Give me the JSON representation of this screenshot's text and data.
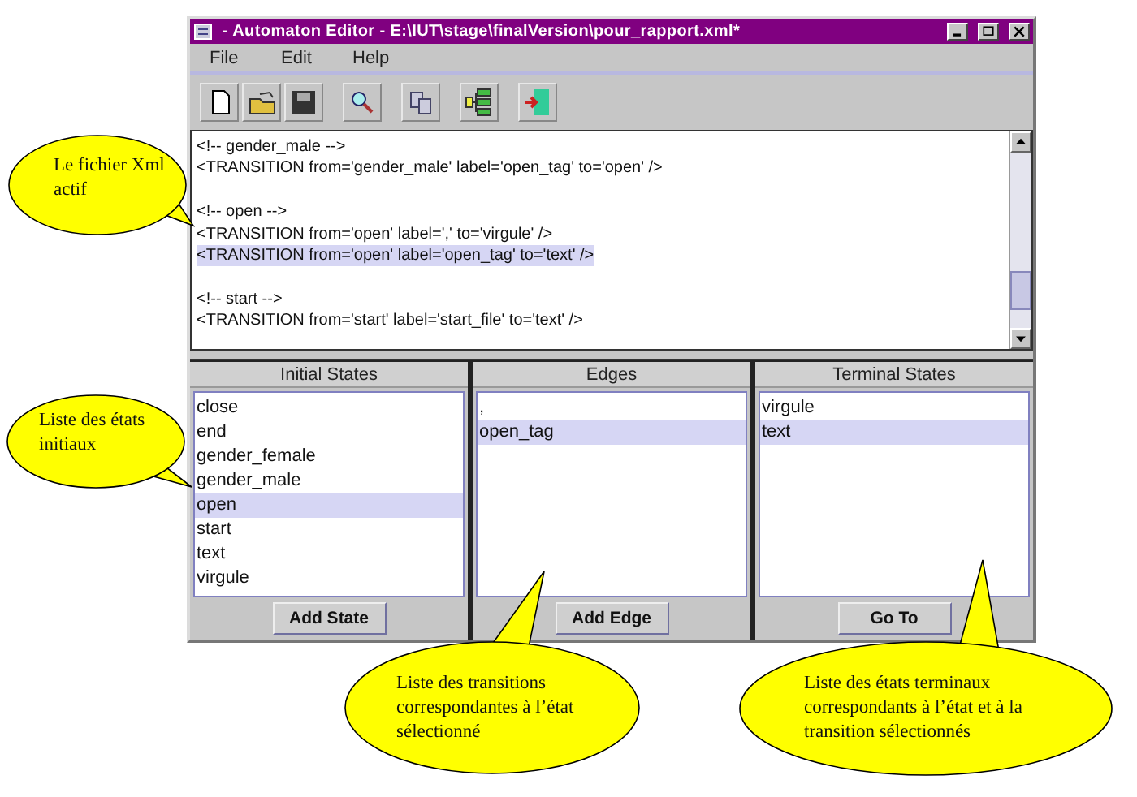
{
  "window": {
    "title": "- Automaton Editor - E:\\IUT\\stage\\finalVersion\\pour_rapport.xml*"
  },
  "menu": [
    "File",
    "Edit",
    "Help"
  ],
  "editor": {
    "lines": [
      {
        "kind": "text",
        "text": "<!-- gender_male -->",
        "selected": false
      },
      {
        "kind": "text",
        "text": "<TRANSITION from='gender_male' label='open_tag' to='open' />",
        "selected": false
      },
      {
        "kind": "blank"
      },
      {
        "kind": "text",
        "text": "<!-- open -->",
        "selected": false
      },
      {
        "kind": "text",
        "text": "<TRANSITION from='open' label=',' to='virgule' />",
        "selected": false
      },
      {
        "kind": "text",
        "text": "<TRANSITION from='open' label='open_tag' to='text' />",
        "selected": true
      },
      {
        "kind": "blank"
      },
      {
        "kind": "text",
        "text": "<!-- start -->",
        "selected": false
      },
      {
        "kind": "text",
        "text": "<TRANSITION from='start' label='start_file' to='text' />",
        "selected": false
      }
    ]
  },
  "panels": [
    {
      "title": "Initial States",
      "button": "Add State",
      "items": [
        {
          "label": "close",
          "selected": false
        },
        {
          "label": "end",
          "selected": false
        },
        {
          "label": "gender_female",
          "selected": false
        },
        {
          "label": "gender_male",
          "selected": false
        },
        {
          "label": "open",
          "selected": true
        },
        {
          "label": "start",
          "selected": false
        },
        {
          "label": "text",
          "selected": false
        },
        {
          "label": "virgule",
          "selected": false
        }
      ]
    },
    {
      "title": "Edges",
      "button": "Add Edge",
      "items": [
        {
          "label": ",",
          "selected": false
        },
        {
          "label": "open_tag",
          "selected": true
        }
      ]
    },
    {
      "title": "Terminal States",
      "button": "Go To",
      "items": [
        {
          "label": "virgule",
          "selected": false
        },
        {
          "label": "text",
          "selected": true
        }
      ]
    }
  ],
  "callouts": [
    {
      "text": "Le fichier Xml actif"
    },
    {
      "text": "Liste des états initiaux"
    },
    {
      "text": "Liste des transitions correspondantes à l’état sélectionné"
    },
    {
      "text": "Liste des états terminaux correspondants à l’état et à la transition sélectionnés"
    }
  ]
}
